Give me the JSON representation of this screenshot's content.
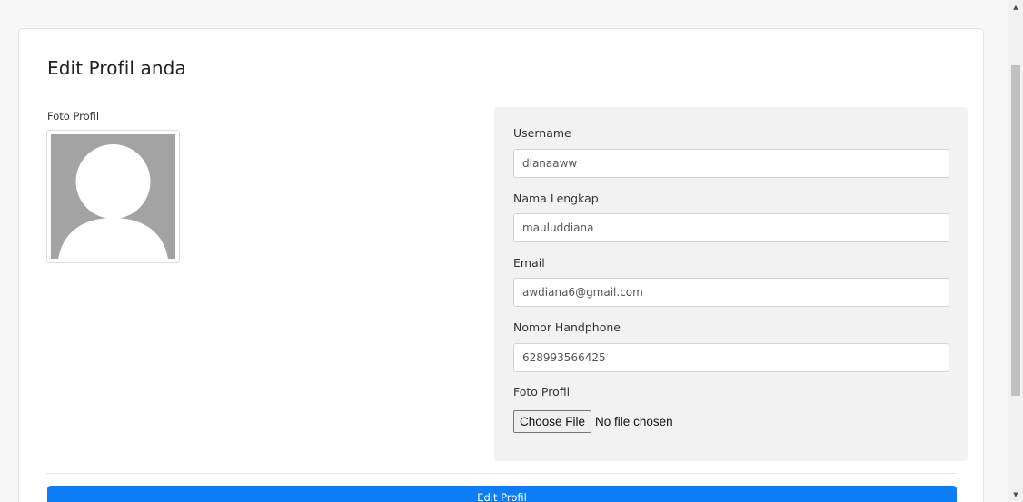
{
  "page": {
    "title": "Edit Profil anda",
    "photo_label": "Foto Profil",
    "avatar_icon": "default-avatar-icon"
  },
  "form": {
    "username_label": "Username",
    "username_value": "dianaaww",
    "fullname_label": "Nama Lengkap",
    "fullname_value": "mauluddiana",
    "email_label": "Email",
    "email_value": "awdiana6@gmail.com",
    "phone_label": "Nomor Handphone",
    "phone_value": "628993566425",
    "photo_label": "Foto Profil",
    "file_button_label": "Choose File",
    "file_status": "No file chosen"
  },
  "actions": {
    "submit_label": "Edit Profil"
  },
  "colors": {
    "primary": "#0d7df5",
    "panel_bg": "#f2f2f2",
    "avatar_bg": "#a3a3a3"
  }
}
